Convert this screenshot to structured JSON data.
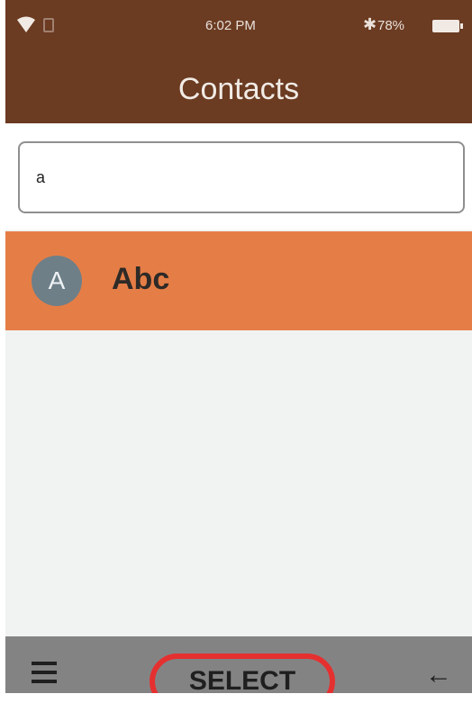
{
  "status_bar": {
    "time": "6:02 PM",
    "bluetooth_icon": "bluetooth-icon",
    "battery_percent": "78%"
  },
  "header": {
    "title": "Contacts"
  },
  "search": {
    "value": "a"
  },
  "contacts": [
    {
      "initial": "A",
      "name": "Abc"
    }
  ],
  "bottom_bar": {
    "menu_icon": "menu-icon",
    "select_label": "SELECT",
    "back_icon": "back-arrow-icon"
  },
  "colors": {
    "header_bg": "#6b3b22",
    "selected_row_bg": "#e57e46",
    "avatar_bg": "#6e7f88",
    "bottom_bar_bg": "#848384",
    "highlight_circle": "#e53030"
  }
}
